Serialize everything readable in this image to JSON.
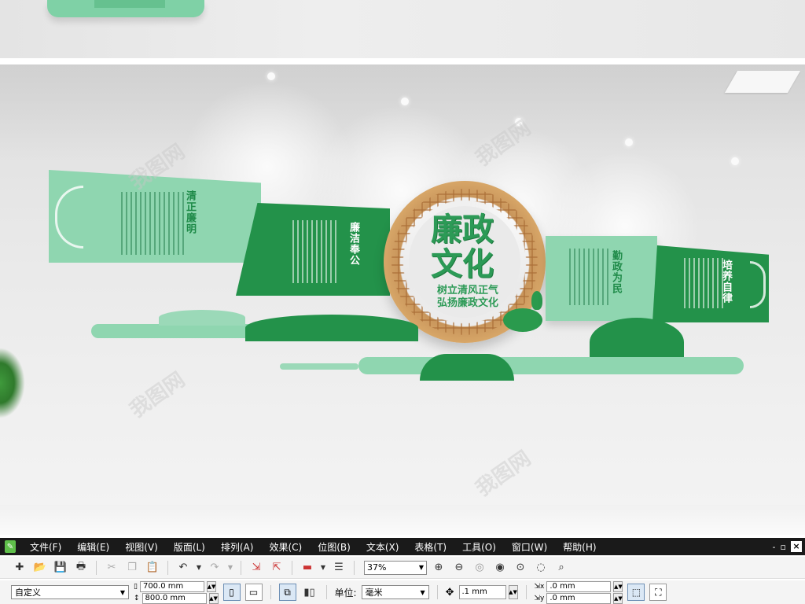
{
  "scene": {
    "panels": [
      {
        "label": "清正廉明"
      },
      {
        "label": "廉洁奉公"
      },
      {
        "label": "勤政为民"
      },
      {
        "label": "培养自律"
      }
    ],
    "center_title": "廉政文化",
    "center_sub_line1": "树立清风正气",
    "center_sub_line2": "弘扬廉政文化",
    "watermark": "我图网",
    "accent_color": "#2c9a56",
    "light_green": "#86d3aa"
  },
  "menubar": {
    "items": [
      "文件(F)",
      "编辑(E)",
      "视图(V)",
      "版面(L)",
      "排列(A)",
      "效果(C)",
      "位图(B)",
      "文本(X)",
      "表格(T)",
      "工具(O)",
      "窗口(W)",
      "帮助(H)"
    ],
    "controls": [
      "-",
      "▫",
      "×"
    ]
  },
  "toolbar": {
    "zoom_value": "37%"
  },
  "propbar": {
    "page_preset": "自定义",
    "width_value": "700.0 mm",
    "height_value": "800.0 mm",
    "unit_label": "单位:",
    "unit_value": "毫米",
    "nudge_value": ".1 mm",
    "dup_x_value": ".0 mm",
    "dup_y_value": ".0 mm"
  }
}
